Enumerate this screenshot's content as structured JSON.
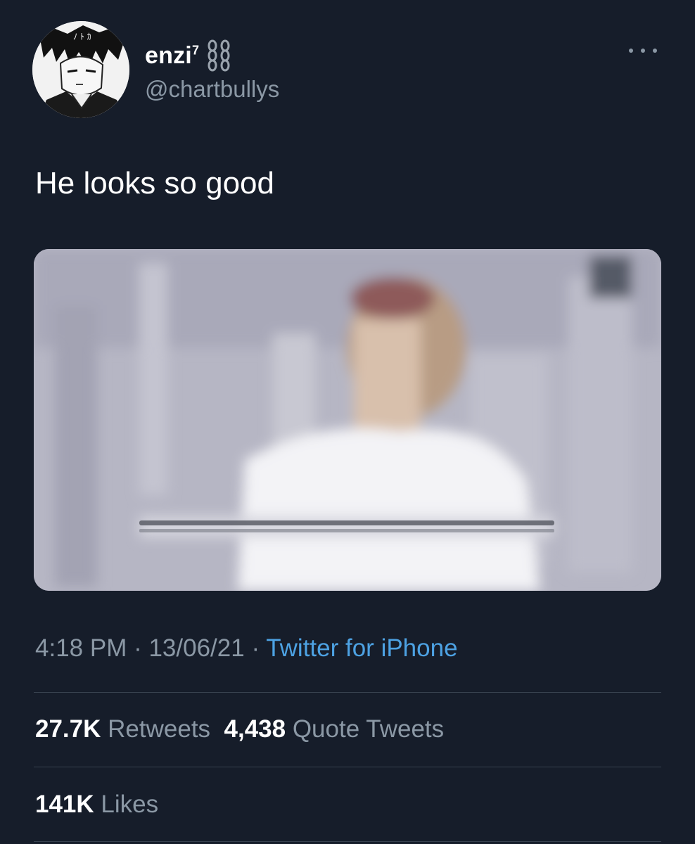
{
  "user": {
    "display_name": "enzi",
    "display_name_sup": "7",
    "handle": "@chartbullys",
    "avatar_icon": "anime-character-avatar",
    "badge_icon": "chain-icon"
  },
  "tweet": {
    "text": "He looks so good",
    "media_icon": "video-thumbnail"
  },
  "meta": {
    "time": "4:18 PM",
    "sep1": " · ",
    "date": "13/06/21",
    "sep2": " · ",
    "source": "Twitter for iPhone"
  },
  "stats": {
    "retweets_count": "27.7K",
    "retweets_label": "Retweets",
    "quotes_count": "4,438",
    "quotes_label": "Quote Tweets",
    "likes_count": "141K",
    "likes_label": "Likes"
  },
  "colors": {
    "background": "#161d2a",
    "text": "#ffffff",
    "secondary": "#8b98a5",
    "link": "#4da2e3",
    "divider": "#38424f"
  }
}
